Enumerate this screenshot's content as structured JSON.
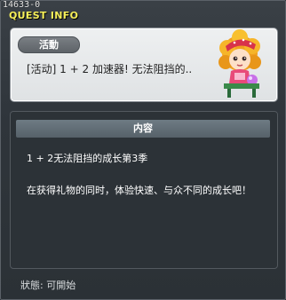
{
  "window": {
    "quest_id": "14633-0",
    "title": "QUEST INFO"
  },
  "quest": {
    "category": "活動",
    "name": "[活动] 1 + 2 加速器! 无法阻挡的.."
  },
  "content": {
    "header": "内容",
    "summary": "1 + 2无法阻挡的成长第3季",
    "description": "在获得礼物的同时，体验快速、与众不同的成长吧！"
  },
  "status": {
    "text": "狀態:  可開始"
  },
  "colors": {
    "title": "#f6ef59",
    "panel_light": "#e6e9eb",
    "panel_dark": "#2c3237",
    "header_bar": "#5f6b73"
  }
}
